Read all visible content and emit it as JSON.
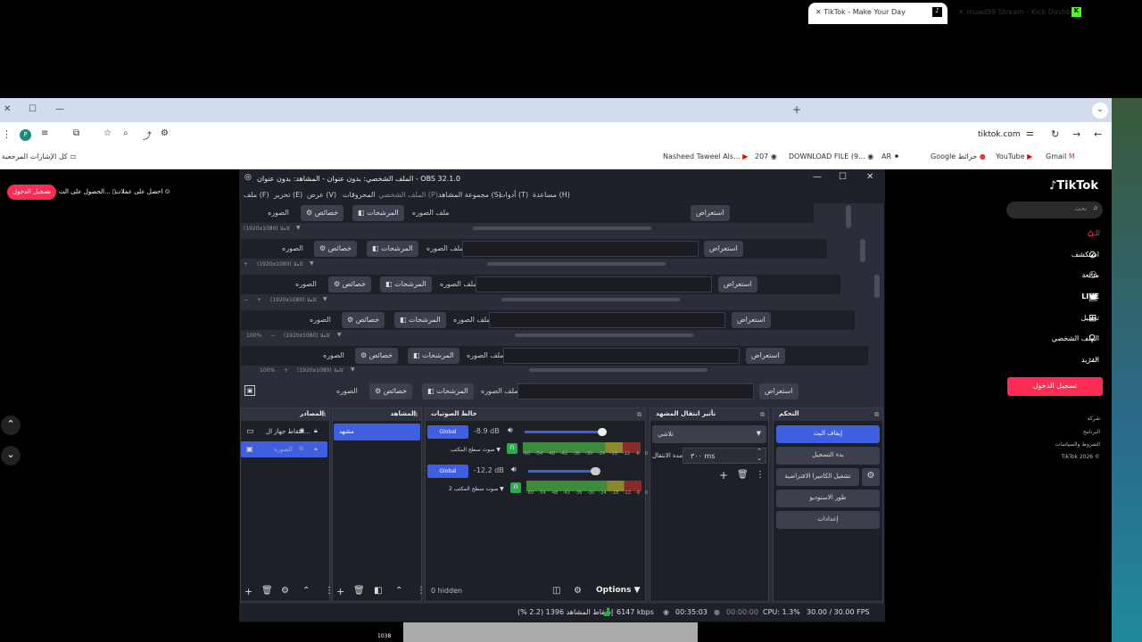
{
  "browser": {
    "tabs": [
      {
        "label": "TikTok - Make Your Day",
        "icon": "tiktok-icon"
      },
      {
        "label": "muad99 Stream - Kick Dashbo",
        "icon": "kick-icon"
      }
    ],
    "url": "tiktok.com",
    "bookmarks": [
      "Nasheed Taweel Als...",
      "207",
      "DOWNLOAD FILE (9...",
      "AR",
      "Google خرائط",
      "YouTube",
      "Gmail"
    ],
    "bookmarks_folder": "كل الإشارات المرجعية"
  },
  "tiktok_page": {
    "top_left_button": "تسجيل الدخول",
    "get_coins": "الحصول على الت...",
    "get_app": "احصل على عملات",
    "brand": "TikTok",
    "search_placeholder": "بحث",
    "nav": [
      "لك",
      "استكشف",
      "متابعة",
      "LIVE",
      "تحميل",
      "الملف الشخصي",
      "المزيد"
    ],
    "login_button": "تسجيل الدخول",
    "footer": [
      "شركة",
      "البرنامج",
      "الشروط والسياسات",
      "TikTok 2026 ©"
    ]
  },
  "obs": {
    "title": "الملف الشخصي: بدون عنوان - المشاهد: بدون عنوان - OBS 32.1.0",
    "menu": [
      "ملف (F)",
      "تحرير (E)",
      "عرض (V)",
      "المحروقات",
      "الملف الشخصي (P)",
      "مجموعة المشاهد (S)",
      "أدوات (T)",
      "مساعدة (H)"
    ],
    "source_rows": [
      {
        "image_label": "الصوره",
        "props": "خصائص",
        "filters": "المرشحات",
        "file_label": "ملف الصوره",
        "browse": "استعراض",
        "res": "(1920x1080) كاملا"
      },
      {
        "image_label": "الصوره",
        "props": "خصائص",
        "filters": "المرشحات",
        "file_label": "ملف الصوره",
        "browse": "استعراض",
        "res": "(1920x1080) كاملا"
      },
      {
        "image_label": "الصوره",
        "props": "خصائص",
        "filters": "المرشحات",
        "file_label": "ملف الصوره",
        "browse": "استعراض",
        "res": "(1920x1080) كاملا"
      },
      {
        "image_label": "الصوره",
        "props": "خصائص",
        "filters": "المرشحات",
        "file_label": "ملف الصوره",
        "browse": "استعراض",
        "res": "(1920x1080) كاملا",
        "zoom": "100%"
      },
      {
        "image_label": "الصوره",
        "props": "خصائص",
        "filters": "المرشحات",
        "file_label": "ملف الصوره",
        "browse": "استعراض",
        "res": "(1920x1080) كاملا",
        "zoom": "100%"
      },
      {
        "image_label": "الصوره",
        "props": "خصائص",
        "filters": "المرشحات",
        "file_label": "ملف الصوره",
        "browse": "استعراض"
      }
    ],
    "docks": {
      "sources": {
        "title": "المصادر",
        "items": [
          "التقاط جهاز ال...",
          "الصوره"
        ]
      },
      "scenes": {
        "title": "المشاهد",
        "items": [
          "مشهد"
        ]
      },
      "mixer": {
        "title": "خالط الصوتيات",
        "channels": [
          {
            "name": "صوت سطح المكتب",
            "db": "-8.9 dB",
            "global": "Global",
            "level": 0.82
          },
          {
            "name": "صوت سطح المكتب 2",
            "db": "-12.2 dB",
            "global": "Global",
            "level": 0.62
          }
        ],
        "ticks": [
          "-60",
          "-54",
          "-48",
          "-42",
          "-36",
          "-30",
          "-24",
          "-18",
          "-12",
          "-6",
          "0"
        ],
        "hidden": "0 hidden",
        "options": "Options"
      },
      "transitions": {
        "title": "تأثير انتقال المشهد",
        "type": "تلاشي",
        "duration_label": "مدة الانتقال",
        "duration": "٣٠٠ ms"
      },
      "controls": {
        "title": "التحكم",
        "buttons": [
          "إيقاف البث",
          "بدء التسجيل",
          "تشغيل الكاميرا الافتراضية",
          "طور الاستوديو",
          "إعدادات"
        ]
      }
    },
    "status": {
      "dropped": "إسقاط المشاهد 1396 (2.2 %)",
      "bitrate": "6147 kbps",
      "time": "00:35:03",
      "rec": "00:00:00",
      "cpu": "CPU: 1.3%",
      "fps": "30.00 / 30.00 FPS"
    }
  },
  "colors": {
    "accent": "#3f5ee0",
    "tiktok_red": "#fe2c55"
  },
  "page_misc": {
    "viewer_count": "1038"
  }
}
